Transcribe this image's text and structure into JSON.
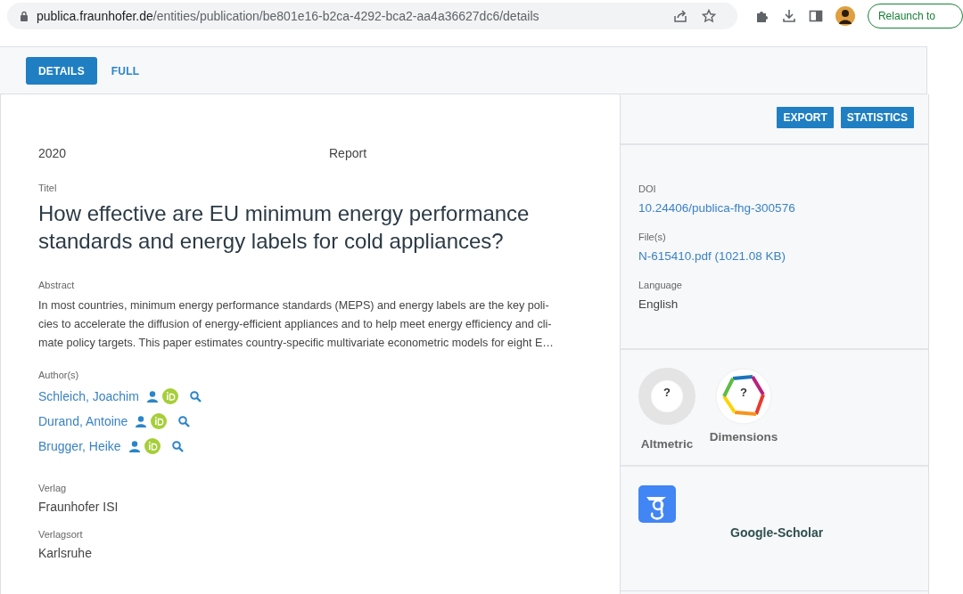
{
  "browser": {
    "url_host": "publica.fraunhofer.de",
    "url_path": "/entities/publication/be801e16-b2ca-4292-bca2-aa4a36627dc6/details",
    "relaunch": "Relaunch to"
  },
  "tabs": [
    {
      "label": "DETAILS",
      "selected": true
    },
    {
      "label": "FULL",
      "selected": false
    }
  ],
  "main": {
    "year": "2020",
    "type": "Report",
    "title_label": "Titel",
    "title": "How effective are EU minimum energy performance standards and energy labels for cold appliances?",
    "abstract_label": "Abstract",
    "abstract": "In most countries, minimum energy performance standards (MEPS) and energy labels are the key poli-\ncies to accelerate the diffusion of energy-efficient appliances and to help meet energy efficiency and cli-\nmate policy targets. This paper estimates country-specific multivariate econometric models for eight E…",
    "authors_label": "Author(s)",
    "authors": [
      {
        "name": "Schleich, Joachim"
      },
      {
        "name": "Durand, Antoine"
      },
      {
        "name": "Brugger, Heike"
      }
    ],
    "fields": [
      {
        "label": "Verlag",
        "value": "Fraunhofer ISI"
      },
      {
        "label": "Verlagsort",
        "value": "Karlsruhe"
      }
    ]
  },
  "side": {
    "buttons": [
      "EXPORT",
      "STATISTICS"
    ],
    "fields": [
      {
        "label": "DOI",
        "value": "10.24406/publica-fhg-300576",
        "kind": "link"
      },
      {
        "label": "File(s)",
        "value": "N-615410.pdf (1021.08 KB)",
        "kind": "link"
      },
      {
        "label": "Language",
        "value": "English",
        "kind": "text"
      }
    ],
    "metrics": [
      {
        "kind": "altmetric",
        "badge": "?",
        "name": "Altmetric"
      },
      {
        "kind": "dimensions",
        "badge": "?",
        "name": "Dimensions"
      }
    ],
    "scholar": "Google-Scholar"
  }
}
